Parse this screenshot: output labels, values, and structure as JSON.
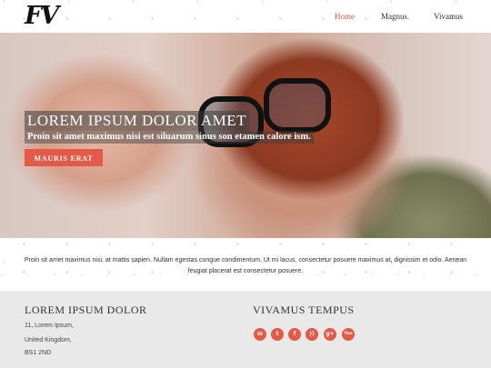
{
  "header": {
    "logo": "FV",
    "nav": [
      {
        "label": "Home"
      },
      {
        "label": "Magnus"
      },
      {
        "label": "Vivamus"
      }
    ]
  },
  "hero": {
    "title": "LOREM IPSUM DOLOR AMET",
    "subtitle": "Proin sit amet maximus nisi est siluarum sinus son etamen calore ism.",
    "button_label": "MAURIS ERAT"
  },
  "intro": {
    "text": "Proin sit amet maximus nisi, at mattis sapien. Nullam egestas congue condimentum. Ut mi lacus, consectetur posuere maximus at, dignissim et odio. Aenean feugiat placerat est consectetur posuere."
  },
  "footer": {
    "left_heading": "LOREM IPSUM DOLOR",
    "address": [
      "11, Lorem Ipsum,",
      "United Kingdom,",
      "BS1 2ND"
    ],
    "right_heading": "VIVAMUS TEMPUS",
    "social": [
      {
        "icon": "linkedin-icon",
        "glyph": "in"
      },
      {
        "icon": "twitter-icon",
        "glyph": "t"
      },
      {
        "icon": "facebook-icon",
        "glyph": "f"
      },
      {
        "icon": "rss-icon",
        "glyph": "))"
      },
      {
        "icon": "google-plus-icon",
        "glyph": "g+"
      },
      {
        "icon": "youtube-icon",
        "glyph": "You"
      }
    ]
  },
  "colors": {
    "accent": "#e35a48",
    "footer_bg": "#e9e9e9"
  }
}
